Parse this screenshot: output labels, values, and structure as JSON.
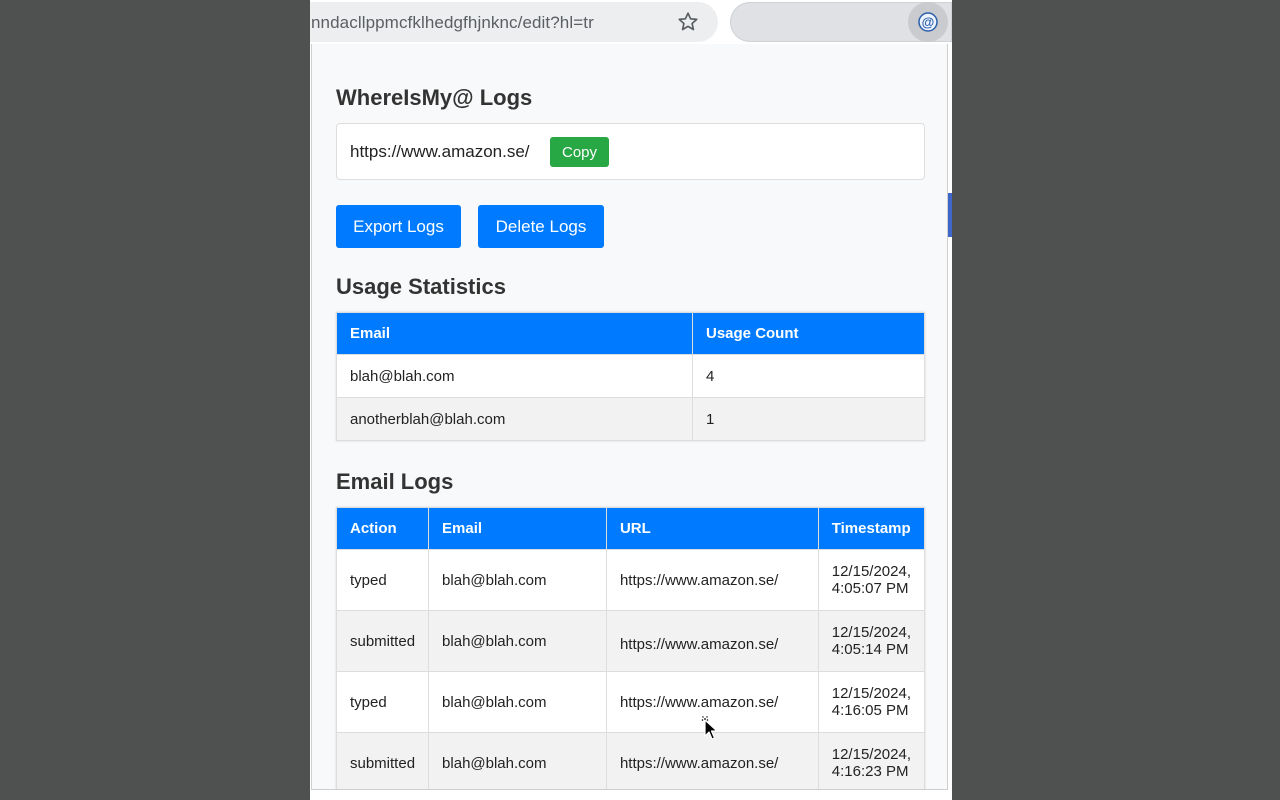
{
  "browser": {
    "url": "nndacllppmcfklhedgfhjnknc/edit?hl=tr",
    "star_icon": "star-icon",
    "extension_icon": "at-sign-icon"
  },
  "popup": {
    "title": "WhereIsMy@ Logs",
    "current_url": "https://www.amazon.se/",
    "copy_label": "Copy",
    "export_label": "Export Logs",
    "delete_label": "Delete Logs",
    "stats_heading": "Usage Statistics",
    "stats_columns": [
      "Email",
      "Usage Count"
    ],
    "stats_rows": [
      [
        "blah@blah.com",
        "4"
      ],
      [
        "anotherblah@blah.com",
        "1"
      ]
    ],
    "logs_heading": "Email Logs",
    "logs_columns": [
      "Action",
      "Email",
      "URL",
      "Timestamp"
    ],
    "logs_rows": [
      [
        "typed",
        "blah@blah.com",
        "https://www.amazon.se/",
        "12/15/2024,",
        "4:05:07 PM"
      ],
      [
        "submitted",
        "blah@blah.com",
        "https://www.amazon.se/",
        "12/15/2024,",
        "4:05:14 PM"
      ],
      [
        "typed",
        "blah@blah.com",
        "https://www.amazon.se/",
        "12/15/2024,",
        "4:16:05 PM"
      ],
      [
        "submitted",
        "blah@blah.com",
        "https://www.amazon.se/",
        "12/15/2024,",
        "4:16:23 PM"
      ]
    ]
  },
  "colors": {
    "primary": "#007bff",
    "copy": "#28a745",
    "backdrop": "#4f5150"
  }
}
